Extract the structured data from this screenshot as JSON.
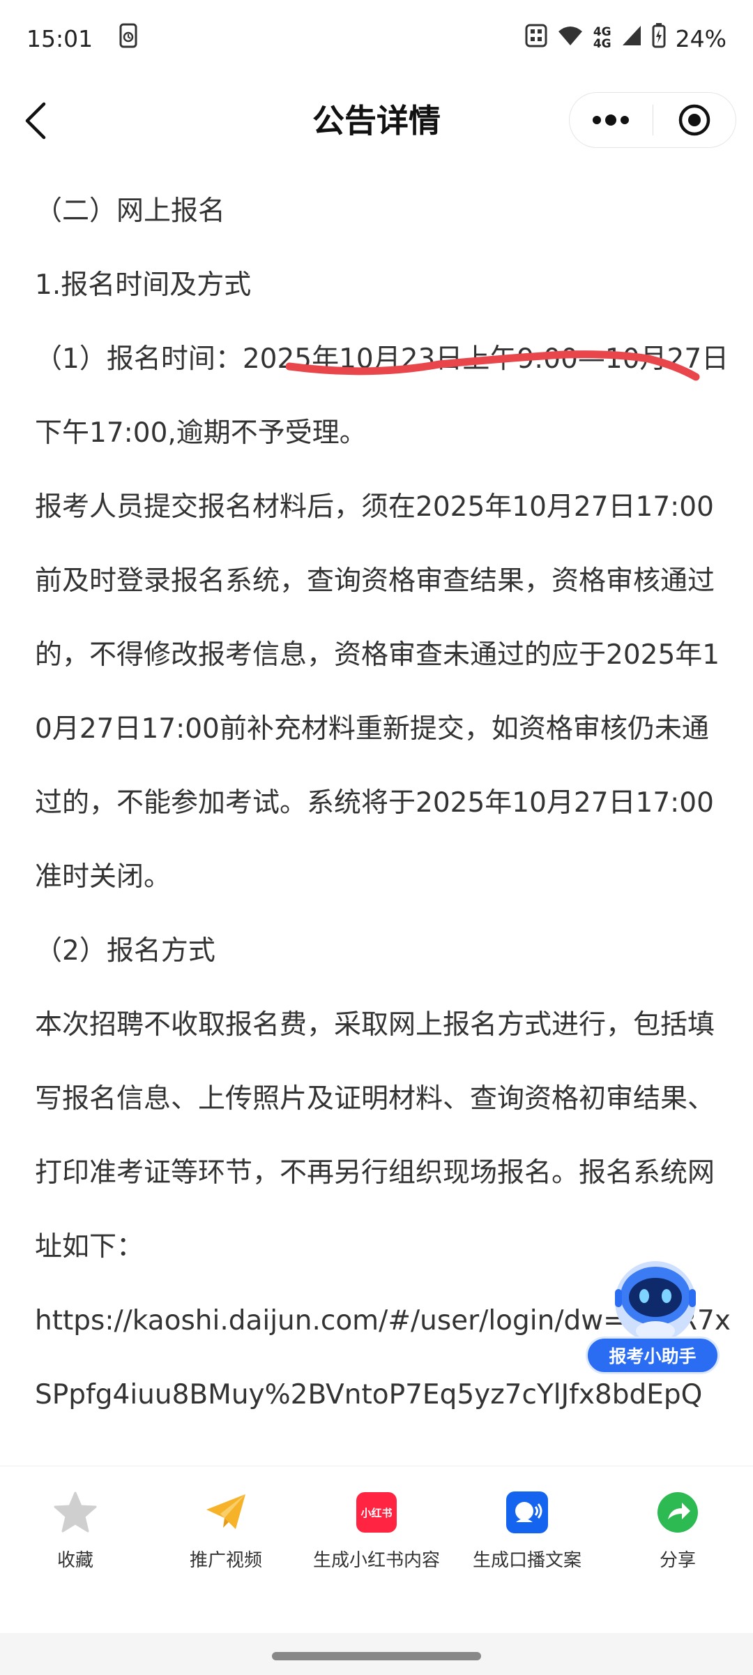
{
  "status_bar": {
    "time": "15:01",
    "network_top": "4G",
    "network_bottom": "4G",
    "battery": "24%"
  },
  "nav": {
    "title": "公告详情"
  },
  "article": {
    "paragraphs": [
      "（二）网上报名",
      "1.报名时间及方式",
      "（1）报名时间：2025年10月23日上午9:00—10月27日下午17:00,逾期不予受理。",
      "报考人员提交报名材料后，须在2025年10月27日17:00前及时登录报名系统，查询资格审查结果，资格审核通过的，不得修改报考信息，资格审查未通过的应于2025年10月27日17:00前补充材料重新提交，如资格审核仍未通过的，不能参加考试。系统将于2025年10月27日17:00准时关闭。",
      "（2）报名方式",
      "本次招聘不收取报名费，采取网上报名方式进行，包括填写报名信息、上传照片及证明材料、查询资格初审结果、打印准考证等环节，不再另行组织现场报名。报名系统网址如下：",
      "https://kaoshi.daijun.com/#/user/login/dw=GFoR7xSPpfg4iuu8BMuy%2BVntoP7Eq5yz7cYlJfx8bdEpQ"
    ]
  },
  "assistant": {
    "label": "报考小助手"
  },
  "toolbar": {
    "items": [
      {
        "label": "收藏"
      },
      {
        "label": "推广视频"
      },
      {
        "label": "生成小红书内容",
        "badge": "小红书"
      },
      {
        "label": "生成口播文案"
      },
      {
        "label": "分享"
      }
    ]
  },
  "colors": {
    "link": "#1a56d6",
    "underline": "#e8464b",
    "accent": "#2a6cf2"
  }
}
